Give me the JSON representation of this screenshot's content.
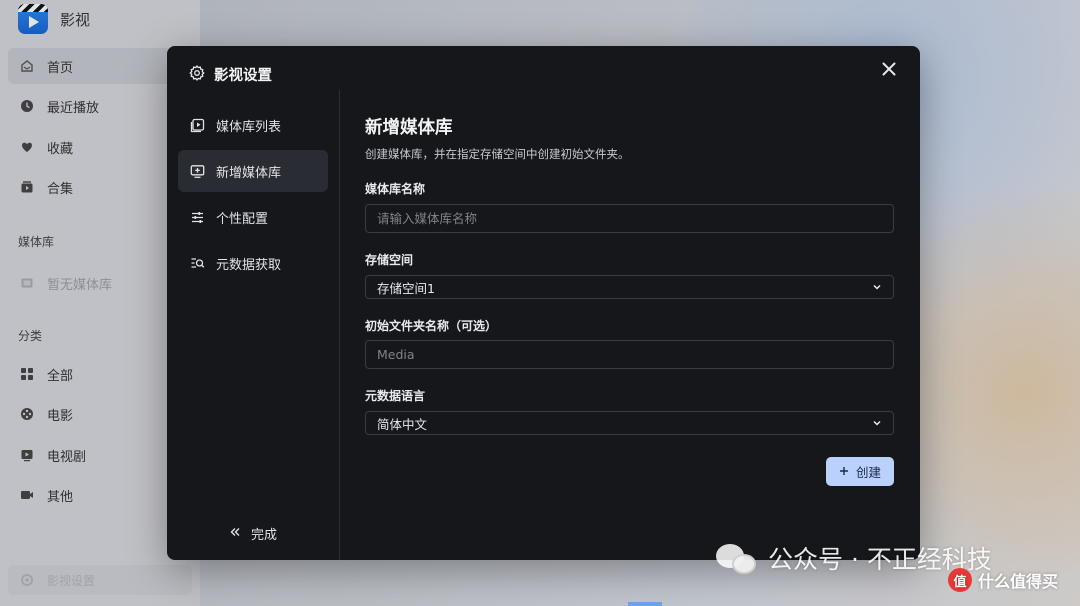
{
  "app": {
    "title": "影视",
    "nav": [
      {
        "label": "首页",
        "icon": "home-icon",
        "active": true
      },
      {
        "label": "最近播放",
        "icon": "clock-icon"
      },
      {
        "label": "收藏",
        "icon": "heart-icon"
      },
      {
        "label": "合集",
        "icon": "collection-icon"
      }
    ],
    "library_section": "媒体库",
    "library_empty": "暂无媒体库",
    "category_section": "分类",
    "categories": [
      {
        "label": "全部",
        "icon": "grid-icon"
      },
      {
        "label": "电影",
        "icon": "film-reel-icon"
      },
      {
        "label": "电视剧",
        "icon": "tv-icon"
      },
      {
        "label": "其他",
        "icon": "video-icon"
      }
    ],
    "bottom_item": "影视设置"
  },
  "modal": {
    "title": "影视设置",
    "sidebar": [
      {
        "label": "媒体库列表",
        "icon": "library-list-icon"
      },
      {
        "label": "新增媒体库",
        "icon": "add-library-icon",
        "active": true
      },
      {
        "label": "个性配置",
        "icon": "sliders-icon"
      },
      {
        "label": "元数据获取",
        "icon": "metadata-search-icon"
      }
    ],
    "done_label": "完成",
    "form": {
      "heading": "新增媒体库",
      "description": "创建媒体库，并在指定存储空间中创建初始文件夹。",
      "name_label": "媒体库名称",
      "name_placeholder": "请输入媒体库名称",
      "name_value": "",
      "storage_label": "存储空间",
      "storage_value": "存储空间1",
      "folder_label": "初始文件夹名称（可选）",
      "folder_placeholder": "Media",
      "folder_value": "",
      "language_label": "元数据语言",
      "language_value": "简体中文",
      "create_label": "创建"
    }
  },
  "watermark": {
    "text": "公众号 · 不正经科技",
    "zdm_badge": "值",
    "zdm_text": "什么值得买"
  },
  "colors": {
    "modal_bg": "#16171b",
    "accent_button": "#b9d1fb",
    "active_item": "#2a2c33"
  }
}
